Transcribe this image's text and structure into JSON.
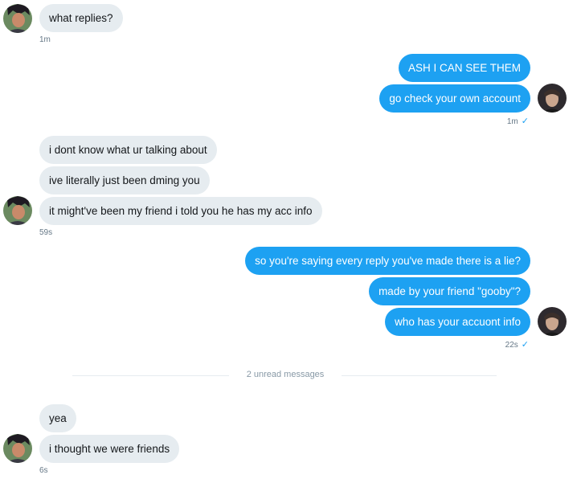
{
  "messages": {
    "m1": "what replies?",
    "m1_time": "1m",
    "m2": "ASH I CAN SEE THEM",
    "m3": "go check your own account",
    "m3_time": "1m",
    "m4": "i dont know what ur talking about",
    "m5": "ive literally just been dming you",
    "m6": "it might've been my friend i told you he has my acc info",
    "m6_time": "59s",
    "m7": "so you're saying every reply you've made there is a lie?",
    "m8": "made by your friend \"gooby\"?",
    "m9": "who has your accuont info",
    "m9_time": "22s",
    "m10": "yea",
    "m11": "i thought we were friends",
    "m11_time": "6s"
  },
  "divider": {
    "label": "2 unread messages"
  },
  "icons": {
    "read_receipt": "check-icon",
    "check_glyph": "✓"
  },
  "colors": {
    "outgoing": "#1da1f2",
    "incoming": "#e6ecf0",
    "muted": "#657786"
  }
}
